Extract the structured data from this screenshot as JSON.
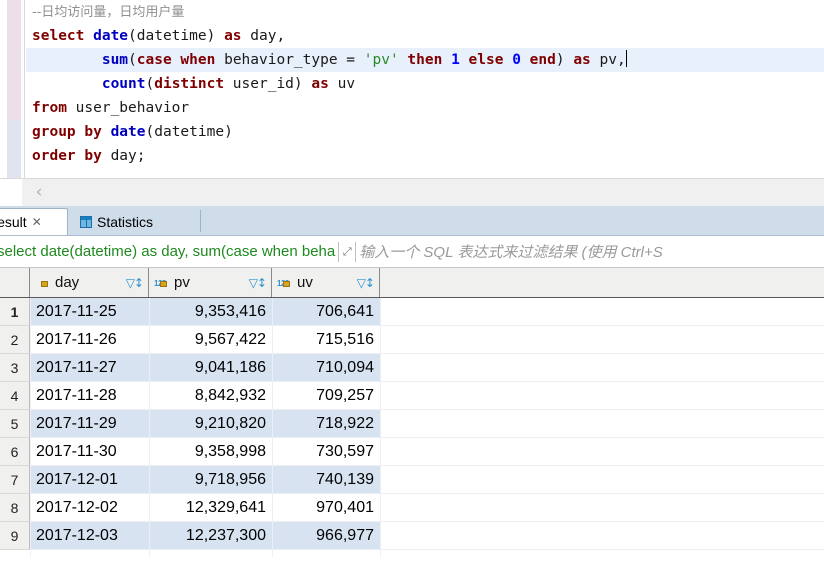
{
  "editor": {
    "lines": [
      {
        "parts": [
          {
            "t": "--日均访问量，日均用户量",
            "c": "comment"
          }
        ],
        "current": false
      },
      {
        "parts": [
          {
            "t": "select ",
            "c": "kw"
          },
          {
            "t": "date",
            "c": "fn"
          },
          {
            "t": "(datetime) ",
            "c": "plain"
          },
          {
            "t": "as",
            "c": "kw"
          },
          {
            "t": " day,",
            "c": "plain"
          }
        ],
        "current": false
      },
      {
        "parts": [
          {
            "t": "        ",
            "c": "plain"
          },
          {
            "t": "sum",
            "c": "fn"
          },
          {
            "t": "(",
            "c": "plain"
          },
          {
            "t": "case when",
            "c": "kw"
          },
          {
            "t": " behavior_type = ",
            "c": "plain"
          },
          {
            "t": "'pv'",
            "c": "str"
          },
          {
            "t": " then",
            "c": "kw"
          },
          {
            "t": " ",
            "c": "plain"
          },
          {
            "t": "1",
            "c": "num"
          },
          {
            "t": " else",
            "c": "kw"
          },
          {
            "t": " ",
            "c": "plain"
          },
          {
            "t": "0",
            "c": "num"
          },
          {
            "t": " end",
            "c": "kw"
          },
          {
            "t": ") ",
            "c": "plain"
          },
          {
            "t": "as",
            "c": "kw"
          },
          {
            "t": " pv,",
            "c": "plain"
          }
        ],
        "current": true
      },
      {
        "parts": [
          {
            "t": "        ",
            "c": "plain"
          },
          {
            "t": "count",
            "c": "fn"
          },
          {
            "t": "(",
            "c": "plain"
          },
          {
            "t": "distinct",
            "c": "kw"
          },
          {
            "t": " user_id) ",
            "c": "plain"
          },
          {
            "t": "as",
            "c": "kw"
          },
          {
            "t": " uv",
            "c": "plain"
          }
        ],
        "current": false
      },
      {
        "parts": [
          {
            "t": "from",
            "c": "kw"
          },
          {
            "t": " user_behavior",
            "c": "plain"
          }
        ],
        "current": false
      },
      {
        "parts": [
          {
            "t": "group by ",
            "c": "kw"
          },
          {
            "t": "date",
            "c": "fn"
          },
          {
            "t": "(datetime)",
            "c": "plain"
          }
        ],
        "current": false
      },
      {
        "parts": [
          {
            "t": "order by",
            "c": "kw"
          },
          {
            "t": " day;",
            "c": "plain"
          }
        ],
        "current": false
      }
    ]
  },
  "toolbar": {
    "collapse_label": "‹"
  },
  "tabs": [
    {
      "label": "Result",
      "icon": "",
      "active": true,
      "closable": true,
      "close_label": "✕"
    },
    {
      "label": "Statistics",
      "icon": "grid-icon",
      "active": false,
      "closable": false,
      "close_label": ""
    }
  ],
  "filter": {
    "query_text": "select date(datetime) as day, sum(case when beha",
    "expand_icon": "⤢",
    "placeholder": "输入一个 SQL 表达式来过滤结果 (使用 Ctrl+S"
  },
  "grid": {
    "columns": [
      {
        "key": "day",
        "label": "day",
        "icon": "clock-lock-icon",
        "sort_icon": "▽↕",
        "align": "left"
      },
      {
        "key": "pv",
        "label": "pv",
        "icon": "number-lock-icon",
        "sort_icon": "▽↕",
        "align": "right"
      },
      {
        "key": "uv",
        "label": "uv",
        "icon": "number-lock-icon",
        "sort_icon": "▽↕",
        "align": "right"
      }
    ],
    "rows": [
      {
        "n": "1",
        "day": "2017-11-25",
        "pv": "9,353,416",
        "uv": "706,641"
      },
      {
        "n": "2",
        "day": "2017-11-26",
        "pv": "9,567,422",
        "uv": "715,516"
      },
      {
        "n": "3",
        "day": "2017-11-27",
        "pv": "9,041,186",
        "uv": "710,094"
      },
      {
        "n": "4",
        "day": "2017-11-28",
        "pv": "8,842,932",
        "uv": "709,257"
      },
      {
        "n": "5",
        "day": "2017-11-29",
        "pv": "9,210,820",
        "uv": "718,922"
      },
      {
        "n": "6",
        "day": "2017-11-30",
        "pv": "9,358,998",
        "uv": "730,597"
      },
      {
        "n": "7",
        "day": "2017-12-01",
        "pv": "9,718,956",
        "uv": "740,139"
      },
      {
        "n": "8",
        "day": "2017-12-02",
        "pv": "12,329,641",
        "uv": "970,401"
      },
      {
        "n": "9",
        "day": "2017-12-03",
        "pv": "12,237,300",
        "uv": "966,977"
      }
    ]
  },
  "colors": {
    "accent_blue": "#2b8fd0",
    "row_highlight": "#d7e3f1",
    "tabbar_bg": "#cfdcea",
    "query_green": "#1f8a1f",
    "keyword_red": "#7f0000",
    "function_blue": "#0000c0",
    "string_green": "#2a8a2a",
    "number_blue": "#0000ff"
  }
}
